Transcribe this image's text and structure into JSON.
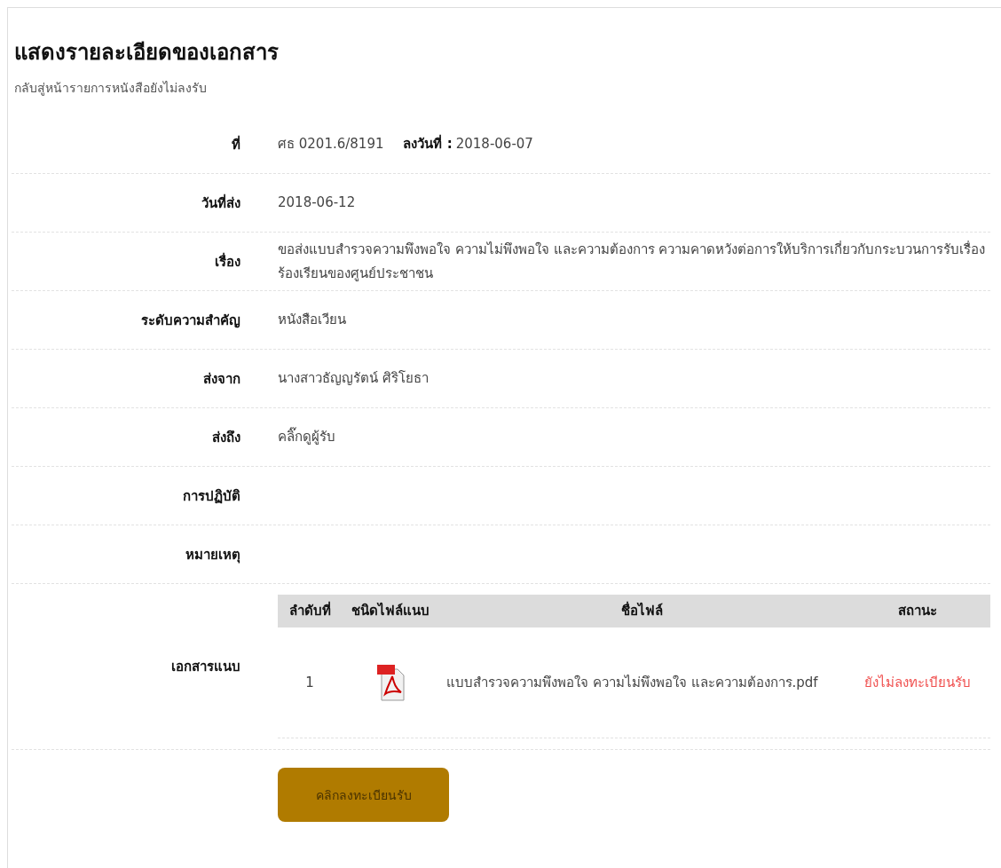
{
  "title": "แสดงรายละเอียดของเอกสาร",
  "back_link": "กลับสู่หน้ารายการหนังสือยังไม่ลงรับ",
  "fields": [
    {
      "kind": "ref",
      "label": "ที่",
      "value": "ศธ 0201.6/8191",
      "date_label": "ลงวันที่ :",
      "date": "2018-06-07"
    },
    {
      "kind": "text",
      "label": "วันที่ส่ง",
      "value": "2018-06-12"
    },
    {
      "kind": "text",
      "label": "เรื่อง",
      "value": "ขอส่งแบบสำรวจความพึงพอใจ ความไม่พึงพอใจ และความต้องการ ความคาดหวังต่อการให้บริการเกี่ยวกับกระบวนการรับเรื่องร้องเรียนของศูนย์ประชาชน"
    },
    {
      "kind": "text",
      "label": "ระดับความสำคัญ",
      "value": "หนังสือเวียน"
    },
    {
      "kind": "text",
      "label": "ส่งจาก",
      "value": "นางสาวธัญญรัตน์ ศิริโยธา"
    },
    {
      "kind": "link",
      "label": "ส่งถึง",
      "value": "คลิ๊กดูผู้รับ"
    },
    {
      "kind": "text",
      "label": "การปฏิบัติ"
    },
    {
      "kind": "text",
      "label": "หมายเหตุ"
    },
    {
      "kind": "attachments",
      "label": "เอกสารแนบ"
    }
  ],
  "attachments": {
    "columns": [
      "ลำดับที่",
      "ชนิดไฟล์แนบ",
      "ชื่อไฟล์",
      "สถานะ"
    ],
    "rows": [
      {
        "number": "1",
        "file_name": "แบบสำรวจความพึงพอใจ ความไม่พึงพอใจ และความต้องการ.pdf",
        "status": "ยังไม่ลงทะเบียนรับ",
        "registered": false
      }
    ]
  },
  "register_button": "คลิกลงทะเบียนรับ"
}
